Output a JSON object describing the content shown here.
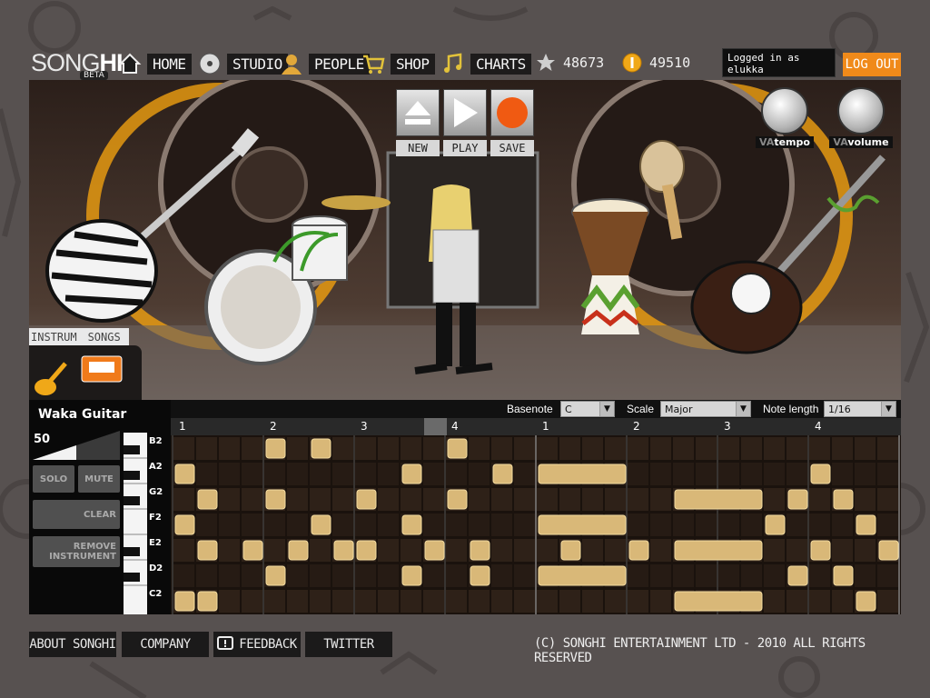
{
  "brand": {
    "logo_part1": "SONG",
    "logo_part2": "HI",
    "badge": "BETA"
  },
  "nav": [
    {
      "label": "HOME",
      "icon": "home-icon"
    },
    {
      "label": "STUDIO",
      "icon": "disc-icon"
    },
    {
      "label": "PEOPLE",
      "icon": "people-icon"
    },
    {
      "label": "SHOP",
      "icon": "cart-icon"
    },
    {
      "label": "CHARTS",
      "icon": "music-note-icon"
    }
  ],
  "stats": {
    "stars": "48673",
    "coins": "49510"
  },
  "session": {
    "login_text": "Logged in as elukka",
    "logout_label": "LOG OUT"
  },
  "transport": {
    "new_label": "NEW",
    "play_label": "PLAY",
    "save_label": "SAVE"
  },
  "knobs": {
    "tempo_label": "tempo",
    "volume_label": "volume",
    "va": "VA"
  },
  "library_tabs": {
    "instruments": "INSTRUM",
    "songs": "SONGS"
  },
  "instrument": {
    "name": "Waka Guitar",
    "volume": "50",
    "solo_label": "SOLO",
    "mute_label": "MUTE",
    "clear_label": "CLEAR",
    "remove_line1": "REMOVE",
    "remove_line2": "INSTRUMENT"
  },
  "sequencer": {
    "basenote_label": "Basenote",
    "basenote_value": "C",
    "scale_label": "Scale",
    "scale_value": "Major",
    "note_length_label": "Note length",
    "note_length_value": "1/16",
    "beats": [
      "1",
      "2",
      "3",
      "4",
      "1",
      "2",
      "3",
      "4"
    ],
    "rows": [
      "B2",
      "A2",
      "G2",
      "F2",
      "E2",
      "D2",
      "C2"
    ],
    "notes": [
      {
        "row": 0,
        "step": 4,
        "len": 1
      },
      {
        "row": 0,
        "step": 6,
        "len": 1
      },
      {
        "row": 0,
        "step": 12,
        "len": 1
      },
      {
        "row": 1,
        "step": 0,
        "len": 1
      },
      {
        "row": 1,
        "step": 10,
        "len": 1
      },
      {
        "row": 1,
        "step": 14,
        "len": 1
      },
      {
        "row": 1,
        "step": 16,
        "len": 4
      },
      {
        "row": 1,
        "step": 28,
        "len": 1
      },
      {
        "row": 2,
        "step": 1,
        "len": 1
      },
      {
        "row": 2,
        "step": 4,
        "len": 1
      },
      {
        "row": 2,
        "step": 8,
        "len": 1
      },
      {
        "row": 2,
        "step": 12,
        "len": 1
      },
      {
        "row": 2,
        "step": 22,
        "len": 4
      },
      {
        "row": 2,
        "step": 27,
        "len": 1
      },
      {
        "row": 2,
        "step": 29,
        "len": 1
      },
      {
        "row": 3,
        "step": 0,
        "len": 1
      },
      {
        "row": 3,
        "step": 6,
        "len": 1
      },
      {
        "row": 3,
        "step": 10,
        "len": 1
      },
      {
        "row": 3,
        "step": 16,
        "len": 4
      },
      {
        "row": 3,
        "step": 26,
        "len": 1
      },
      {
        "row": 3,
        "step": 30,
        "len": 1
      },
      {
        "row": 4,
        "step": 1,
        "len": 1
      },
      {
        "row": 4,
        "step": 3,
        "len": 1
      },
      {
        "row": 4,
        "step": 5,
        "len": 1
      },
      {
        "row": 4,
        "step": 7,
        "len": 1
      },
      {
        "row": 4,
        "step": 8,
        "len": 1
      },
      {
        "row": 4,
        "step": 11,
        "len": 1
      },
      {
        "row": 4,
        "step": 13,
        "len": 1
      },
      {
        "row": 4,
        "step": 17,
        "len": 1
      },
      {
        "row": 4,
        "step": 20,
        "len": 1
      },
      {
        "row": 4,
        "step": 22,
        "len": 4
      },
      {
        "row": 4,
        "step": 28,
        "len": 1
      },
      {
        "row": 4,
        "step": 31,
        "len": 1
      },
      {
        "row": 5,
        "step": 4,
        "len": 1
      },
      {
        "row": 5,
        "step": 10,
        "len": 1
      },
      {
        "row": 5,
        "step": 13,
        "len": 1
      },
      {
        "row": 5,
        "step": 16,
        "len": 4
      },
      {
        "row": 5,
        "step": 27,
        "len": 1
      },
      {
        "row": 5,
        "step": 29,
        "len": 1
      },
      {
        "row": 6,
        "step": 0,
        "len": 1
      },
      {
        "row": 6,
        "step": 1,
        "len": 1
      },
      {
        "row": 6,
        "step": 22,
        "len": 4
      },
      {
        "row": 6,
        "step": 30,
        "len": 1
      }
    ]
  },
  "footer": {
    "about_label": "ABOUT SONGHI",
    "company_label": "COMPANY",
    "feedback_label": "FEEDBACK",
    "twitter_label": "TWITTER",
    "copyright": "(C) SONGHI ENTERTAINMENT LTD - 2010 ALL RIGHTS RESERVED"
  },
  "colors": {
    "accent": "#f08a1a",
    "note": "#d9b878",
    "grid_bg": "#1a120d"
  }
}
